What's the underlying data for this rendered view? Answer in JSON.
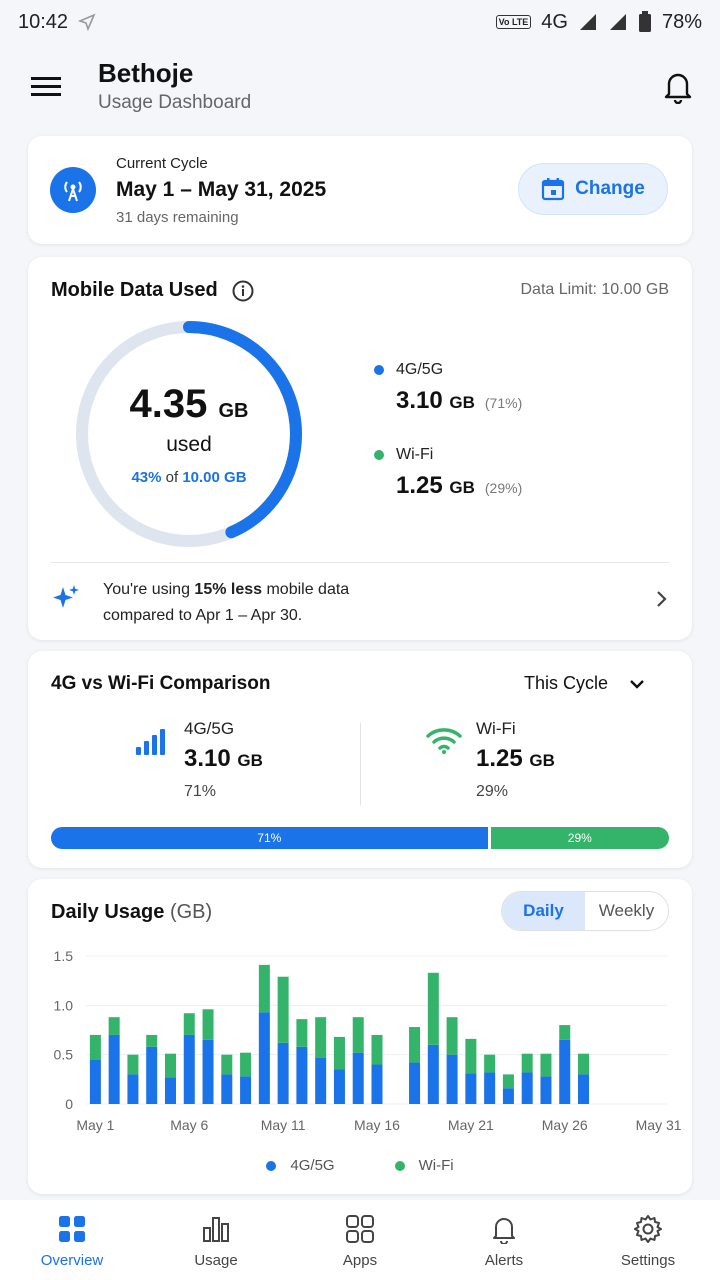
{
  "status": {
    "time": "10:42",
    "network": "4G",
    "volte": "Vo LTE",
    "battery": "78%"
  },
  "header": {
    "title": "Bethoje",
    "subtitle": "Usage Dashboard"
  },
  "cycle": {
    "label": "Current Cycle",
    "range": "May 1 – May 31, 2025",
    "remaining": "31 days remaining",
    "change_label": "Change"
  },
  "usage": {
    "title": "Mobile Data Used",
    "limit": "Data Limit: 10.00 GB",
    "total_value": "4.35",
    "total_unit": "GB",
    "used_label": "used",
    "pct_text": "43%",
    "of_text": "of",
    "limit_text": "10.00 GB",
    "fraction": 0.435,
    "mobile": {
      "name": "4G/5G",
      "value": "3.10",
      "unit": "GB",
      "pct": "(71%)"
    },
    "wifi": {
      "name": "Wi-Fi",
      "value": "1.25",
      "unit": "GB",
      "pct": "(29%)"
    },
    "insight_pre": "You're using ",
    "insight_bold": "15% less",
    "insight_post": " mobile data",
    "insight_line2": "compared to Apr 1 – Apr 30."
  },
  "compare": {
    "title": "4G vs Wi-Fi Comparison",
    "period": "This Cycle",
    "mobile": {
      "name": "4G/5G",
      "value": "3.10",
      "unit": "GB",
      "pct": "71%",
      "fraction": 0.71
    },
    "wifi": {
      "name": "Wi-Fi",
      "value": "1.25",
      "unit": "GB",
      "pct": "29%",
      "fraction": 0.29
    }
  },
  "daily": {
    "title": "Daily Usage",
    "unit": "(GB)",
    "toggle": [
      "Daily",
      "Weekly"
    ],
    "legend": [
      "4G/5G",
      "Wi-Fi"
    ]
  },
  "colors": {
    "mobile": "#1a73e8",
    "wifi": "#34b36b",
    "ring_track": "#dfe5ef"
  },
  "chart_data": {
    "type": "bar",
    "stacked": true,
    "x": [
      "May 1",
      "May 2",
      "May 3",
      "May 4",
      "May 5",
      "May 6",
      "May 7",
      "May 8",
      "May 9",
      "May 10",
      "May 11",
      "May 12",
      "May 13",
      "May 14",
      "May 15",
      "May 16",
      "May 17",
      "May 18",
      "May 19",
      "May 20",
      "May 21",
      "May 22",
      "May 23",
      "May 24",
      "May 25",
      "May 26",
      "May 27",
      "May 28",
      "May 29",
      "May 30",
      "May 31"
    ],
    "tick_labels": [
      "May 1",
      "May 6",
      "May 11",
      "May 16",
      "May 21",
      "May 26",
      "May 31"
    ],
    "series": [
      {
        "name": "4G/5G",
        "values": [
          0.45,
          0.7,
          0.3,
          0.58,
          0.27,
          0.7,
          0.65,
          0.3,
          0.28,
          0.93,
          0.62,
          0.58,
          0.47,
          0.35,
          0.52,
          0.4,
          0.0,
          0.42,
          0.6,
          0.5,
          0.31,
          0.32,
          0.16,
          0.32,
          0.28,
          0.65,
          0.3,
          0.0,
          0.0,
          0.0,
          0.0
        ]
      },
      {
        "name": "Wi-Fi",
        "values": [
          0.25,
          0.18,
          0.2,
          0.12,
          0.24,
          0.22,
          0.31,
          0.2,
          0.24,
          0.48,
          0.67,
          0.28,
          0.41,
          0.33,
          0.36,
          0.3,
          0.0,
          0.36,
          0.73,
          0.38,
          0.35,
          0.18,
          0.14,
          0.19,
          0.23,
          0.15,
          0.21,
          0.0,
          0.0,
          0.0,
          0.0
        ]
      }
    ],
    "ylim": [
      0,
      1.5
    ],
    "yticks": [
      "0",
      "0.5",
      "1.0",
      "1.5"
    ],
    "ylabel": "",
    "xlabel": "",
    "legend": "bottom"
  }
}
